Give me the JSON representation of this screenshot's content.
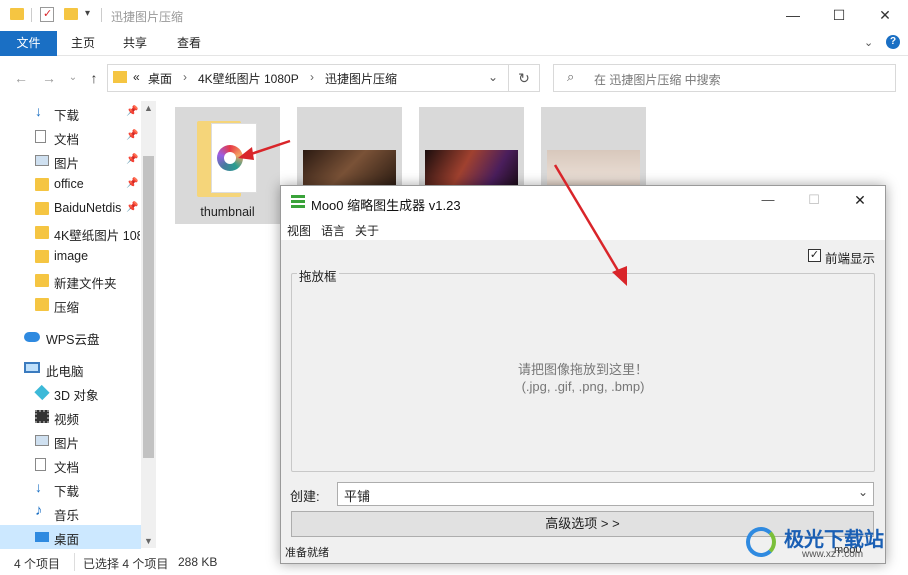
{
  "explorer": {
    "title": "迅捷图片压缩",
    "window_controls": {
      "minimize": "—",
      "maximize": "☐",
      "close": "✕"
    },
    "ribbon_tabs": [
      "文件",
      "主页",
      "共享",
      "查看"
    ],
    "breadcrumb": [
      "«",
      "桌面",
      "›",
      "4K壁纸图片 1080P",
      "›",
      "迅捷图片压缩"
    ],
    "search_placeholder": "在 迅捷图片压缩 中搜索",
    "sidebar": [
      {
        "label": "下载",
        "icon": "download-icon",
        "pinned": true
      },
      {
        "label": "文档",
        "icon": "document-icon",
        "pinned": true
      },
      {
        "label": "图片",
        "icon": "picture-icon",
        "pinned": true
      },
      {
        "label": "office",
        "icon": "folder-icon",
        "pinned": true
      },
      {
        "label": "BaiduNetdis",
        "icon": "folder-icon",
        "pinned": true
      },
      {
        "label": "4K壁纸图片 108",
        "icon": "folder-icon",
        "pinned": false
      },
      {
        "label": "image",
        "icon": "folder-icon",
        "pinned": false
      },
      {
        "label": "新建文件夹",
        "icon": "folder-icon",
        "pinned": false
      },
      {
        "label": "压缩",
        "icon": "folder-icon",
        "pinned": false
      },
      {
        "label": "WPS云盘",
        "icon": "cloud-icon",
        "pinned": false
      },
      {
        "label": "此电脑",
        "icon": "computer-icon",
        "pinned": false
      },
      {
        "label": "3D 对象",
        "icon": "cube-icon",
        "pinned": false
      },
      {
        "label": "视频",
        "icon": "video-icon",
        "pinned": false
      },
      {
        "label": "图片",
        "icon": "picture-icon",
        "pinned": false
      },
      {
        "label": "文档",
        "icon": "document-icon",
        "pinned": false
      },
      {
        "label": "下载",
        "icon": "download-icon",
        "pinned": false
      },
      {
        "label": "音乐",
        "icon": "music-icon",
        "pinned": false
      },
      {
        "label": "桌面",
        "icon": "desktop-icon",
        "pinned": false
      }
    ],
    "files": [
      {
        "name": "thumbnail",
        "type": "folder"
      },
      {
        "name": "",
        "type": "image"
      },
      {
        "name": "",
        "type": "image"
      },
      {
        "name": "",
        "type": "image"
      }
    ],
    "status": {
      "count": "4 个项目",
      "selected": "已选择 4 个项目",
      "size": "288 KB"
    }
  },
  "moo": {
    "title": "Moo0 缩略图生成器 v1.23",
    "menu": [
      "视图",
      "语言",
      "关于"
    ],
    "always_on_top": "前端显示",
    "group_label": "拖放框",
    "drop_hint": "请把图像拖放到这里！",
    "drop_formats": "(.jpg, .gif, .png, .bmp)",
    "create_label": "创建:",
    "create_value": "平铺",
    "advanced_button": "高级选项 > >",
    "status": "准备就绪",
    "brand": "moo0"
  },
  "watermark": {
    "text": "极光下载站",
    "url": "www.xz7.com"
  },
  "colors": {
    "accent": "#1a6fc4",
    "arrow": "#d9252a",
    "selection": "#cce8ff"
  }
}
